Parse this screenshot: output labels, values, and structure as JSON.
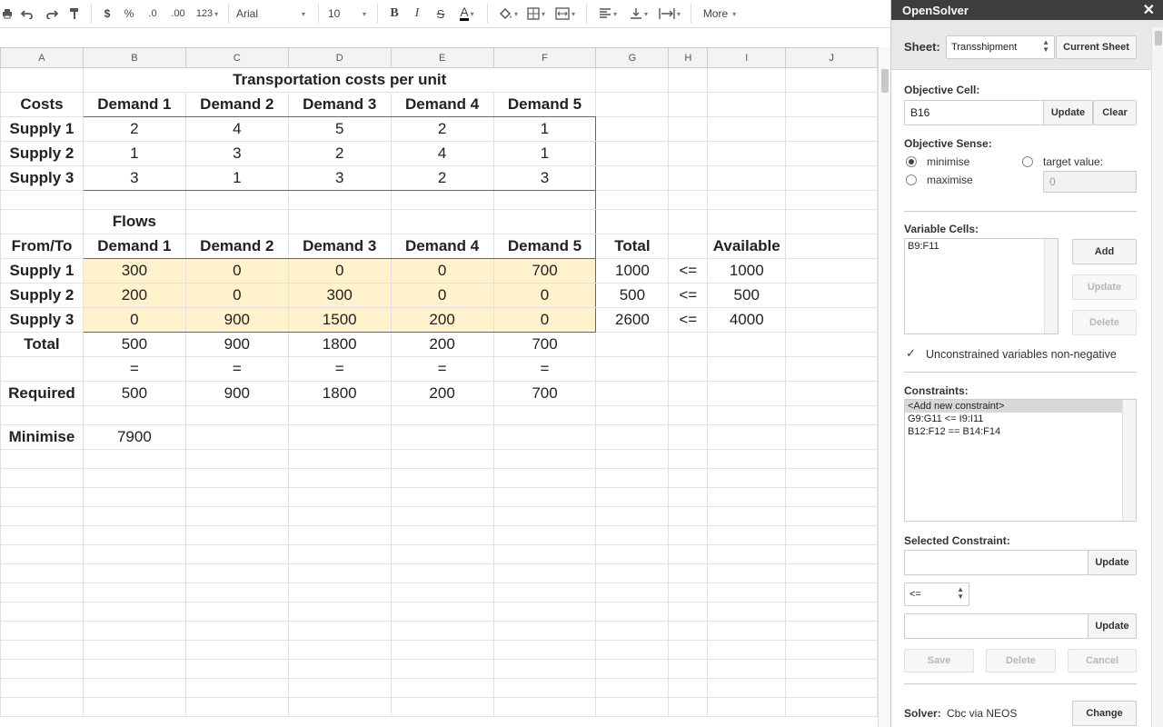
{
  "toolbar": {
    "currency": "$",
    "percent": "%",
    "decrease_decimals": ".0",
    "increase_decimals": ".00",
    "more_formats": "123",
    "font": "Arial",
    "font_size": "10",
    "bold": "B",
    "italic": "I",
    "strike": "S",
    "text_color": "A",
    "more": "More"
  },
  "columns": [
    "A",
    "B",
    "C",
    "D",
    "E",
    "F",
    "G",
    "H",
    "I",
    "J"
  ],
  "sheet": {
    "title": "Transportation costs per unit",
    "costs_label": "Costs",
    "demand_headers": [
      "Demand 1",
      "Demand 2",
      "Demand 3",
      "Demand 4",
      "Demand 5"
    ],
    "cost_rows": [
      {
        "label": "Supply 1",
        "values": [
          "2",
          "4",
          "5",
          "2",
          "1"
        ]
      },
      {
        "label": "Supply 2",
        "values": [
          "1",
          "3",
          "2",
          "4",
          "1"
        ]
      },
      {
        "label": "Supply 3",
        "values": [
          "3",
          "1",
          "3",
          "2",
          "3"
        ]
      }
    ],
    "flows_label": "Flows",
    "fromto_label": "From/To",
    "total_header": "Total",
    "available_header": "Available",
    "flow_rows": [
      {
        "label": "Supply 1",
        "values": [
          "300",
          "0",
          "0",
          "0",
          "700"
        ],
        "total": "1000",
        "op": "<=",
        "available": "1000"
      },
      {
        "label": "Supply 2",
        "values": [
          "200",
          "0",
          "300",
          "0",
          "0"
        ],
        "total": "500",
        "op": "<=",
        "available": "500"
      },
      {
        "label": "Supply 3",
        "values": [
          "0",
          "900",
          "1500",
          "200",
          "0"
        ],
        "total": "2600",
        "op": "<=",
        "available": "4000"
      }
    ],
    "total_label": "Total",
    "totals": [
      "500",
      "900",
      "1800",
      "200",
      "700"
    ],
    "equals": [
      "=",
      "=",
      "=",
      "=",
      "="
    ],
    "required_label": "Required",
    "required": [
      "500",
      "900",
      "1800",
      "200",
      "700"
    ],
    "minimise_label": "Minimise",
    "minimise_value": "7900"
  },
  "panel": {
    "title": "OpenSolver",
    "close": "✕",
    "sheet_label": "Sheet:",
    "sheet_value": "Transshipment",
    "current_sheet": "Current Sheet",
    "objective_cell_label": "Objective Cell:",
    "objective_cell_value": "B16",
    "update": "Update",
    "clear": "Clear",
    "objective_sense_label": "Objective Sense:",
    "minimise": "minimise",
    "maximise": "maximise",
    "target_value": "target value:",
    "target_placeholder": "0",
    "variable_cells_label": "Variable Cells:",
    "variable_cells": [
      "B9:F11"
    ],
    "add": "Add",
    "delete": "Delete",
    "nonneg_label": "Unconstrained variables non-negative",
    "nonneg_checked": "✓",
    "constraints_label": "Constraints:",
    "constraints": [
      "<Add new constraint>",
      "G9:G11 <= I9:I11",
      "B12:F12 == B14:F14"
    ],
    "selected_constraint_label": "Selected Constraint:",
    "relation": "<=",
    "save": "Save",
    "cancel": "Cancel",
    "solver_label": "Solver:",
    "solver_value": "Cbc via NEOS",
    "change": "Change"
  }
}
